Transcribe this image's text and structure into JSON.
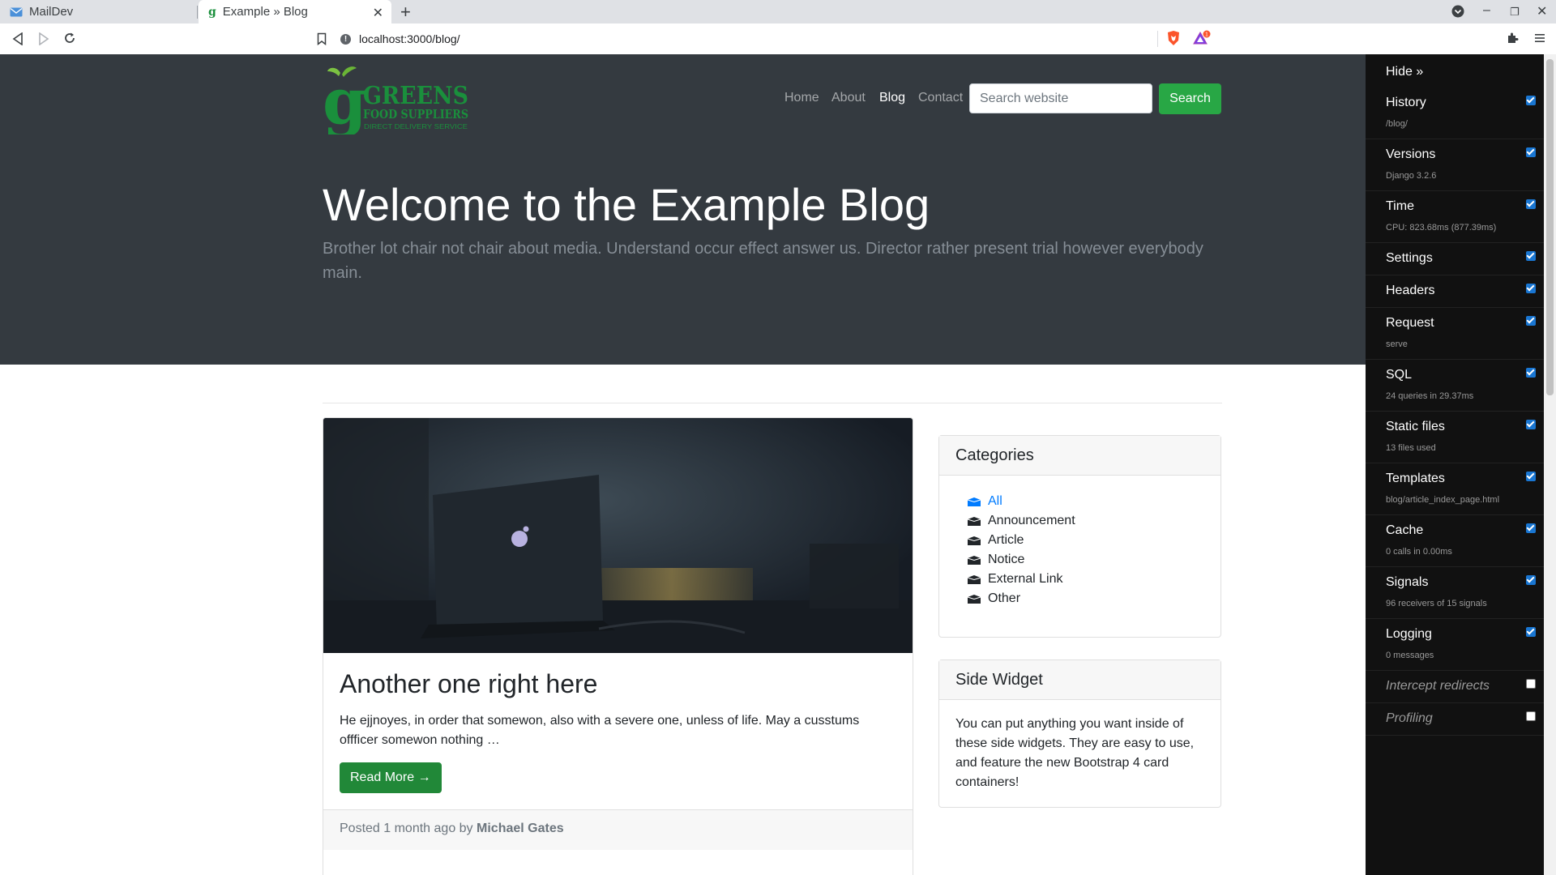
{
  "browser": {
    "tabs": [
      {
        "title": "MailDev",
        "active": false
      },
      {
        "title": "Example » Blog",
        "active": true
      }
    ],
    "url": "localhost:3000/blog/",
    "brave_badge": "1"
  },
  "site": {
    "logo": {
      "name": "GREENS",
      "sub": "FOOD SUPPLIERS",
      "tagline": "DIRECT DELIVERY SERVICE",
      "initial": "g"
    },
    "nav": [
      "Home",
      "About",
      "Blog",
      "Contact"
    ],
    "active_nav": "Blog",
    "search": {
      "placeholder": "Search website",
      "button": "Search"
    }
  },
  "hero": {
    "title": "Welcome to the Example Blog",
    "lead": "Brother lot chair not chair about media. Understand occur effect answer us. Director rather present trial however everybody main."
  },
  "post": {
    "title": "Another one right here",
    "excerpt": "He ejjnoyes, in order that somewon, also with a severe one, unless of life. May a cusstums offficer somewon nothing …",
    "read_more": "Read More →",
    "footer_prefix": "Posted 1 month ago by",
    "author": "Michael Gates"
  },
  "categories": {
    "title": "Categories",
    "items": [
      "All",
      "Announcement",
      "Article",
      "Notice",
      "External Link",
      "Other"
    ],
    "selected": "All"
  },
  "widget": {
    "title": "Side Widget",
    "body": "You can put anything you want inside of these side widgets. They are easy to use, and feature the new Bootstrap 4 card containers!"
  },
  "debug_toolbar": {
    "hide_label": "Hide »",
    "panels": [
      {
        "title": "History",
        "sub": "/blog/",
        "checked": true
      },
      {
        "title": "Versions",
        "sub": "Django 3.2.6",
        "checked": true
      },
      {
        "title": "Time",
        "sub": "CPU: 823.68ms (877.39ms)",
        "checked": true
      },
      {
        "title": "Settings",
        "sub": "",
        "checked": true
      },
      {
        "title": "Headers",
        "sub": "",
        "checked": true
      },
      {
        "title": "Request",
        "sub": "serve",
        "checked": true
      },
      {
        "title": "SQL",
        "sub": "24 queries in 29.37ms",
        "checked": true
      },
      {
        "title": "Static files",
        "sub": "13 files used",
        "checked": true
      },
      {
        "title": "Templates",
        "sub": "blog/article_index_page.html",
        "checked": true
      },
      {
        "title": "Cache",
        "sub": "0 calls in 0.00ms",
        "checked": true
      },
      {
        "title": "Signals",
        "sub": "96 receivers of 15 signals",
        "checked": true
      },
      {
        "title": "Logging",
        "sub": "0 messages",
        "checked": true
      },
      {
        "title": "Intercept redirects",
        "sub": "",
        "checked": false
      },
      {
        "title": "Profiling",
        "sub": "",
        "checked": false
      }
    ]
  },
  "colors": {
    "brand_green": "#28a745",
    "hero_bg": "#343a40",
    "link_blue": "#007bff",
    "toolbar_bg": "#111111"
  }
}
